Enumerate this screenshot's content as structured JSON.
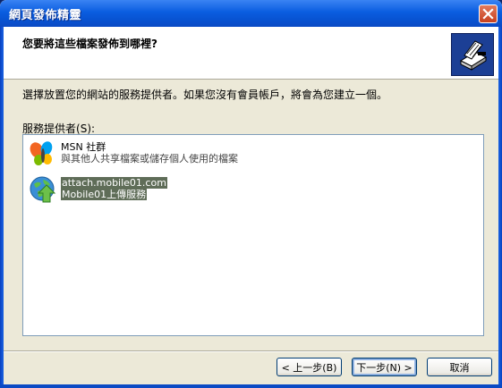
{
  "window": {
    "title": "網頁發佈精靈"
  },
  "header": {
    "question": "您要將這些檔案發佈到哪裡?"
  },
  "instruction": "選擇放置您的網站的服務提供者。如果您沒有會員帳戶，將會為您建立一個。",
  "providers_label": {
    "text": "服務提供者",
    "accel": "(S):"
  },
  "providers": [
    {
      "name": "MSN 社群",
      "description": "與其他人共享檔案或儲存個人使用的檔案",
      "icon": "msn-butterfly-icon",
      "selected": false
    },
    {
      "name": "attach.mobile01.com",
      "description": "Mobile01上傳服務",
      "icon": "globe-upload-icon",
      "selected": true
    }
  ],
  "buttons": {
    "back": "< 上一步(B)",
    "next": "下一步(N) >",
    "cancel": "取消"
  },
  "colors": {
    "titlebar": "#0a5de0",
    "selection": "#5f6d58",
    "close": "#c7401f"
  }
}
